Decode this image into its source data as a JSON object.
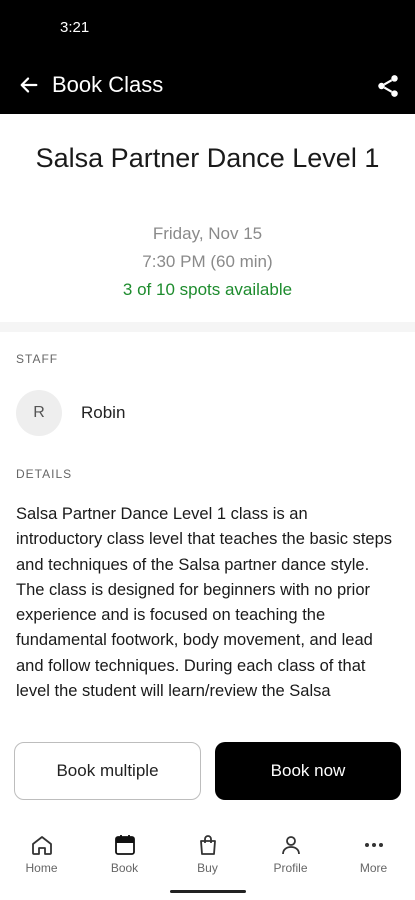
{
  "status_bar": {
    "time": "3:21"
  },
  "app_bar": {
    "title": "Book Class",
    "back_icon": "arrow-left-icon",
    "share_icon": "share-icon"
  },
  "class_info": {
    "title": "Salsa Partner Dance Level 1",
    "date": "Friday, Nov 15",
    "time": "7:30 PM (60 min)",
    "spots": "3 of 10 spots available"
  },
  "staff": {
    "label": "STAFF",
    "avatar_initial": "R",
    "name": "Robin"
  },
  "details": {
    "label": "DETAILS",
    "text": "Salsa Partner Dance Level 1 class is an introductory class level that teaches the basic steps and techniques of the Salsa partner dance style. The class is designed for beginners with no prior experience and is focused on teaching the fundamental footwork, body movement, and lead and follow techniques. During each class of that level the student will learn/review the Salsa"
  },
  "actions": {
    "book_multiple": "Book multiple",
    "book_now": "Book now"
  },
  "bottom_nav": {
    "items": [
      {
        "label": "Home",
        "icon": "home-icon"
      },
      {
        "label": "Book",
        "icon": "calendar-icon"
      },
      {
        "label": "Buy",
        "icon": "shopping-bag-icon"
      },
      {
        "label": "Profile",
        "icon": "person-icon"
      },
      {
        "label": "More",
        "icon": "more-dots-icon"
      }
    ]
  },
  "colors": {
    "bar_background": "#000000",
    "spots_green": "#1e8c2e",
    "muted_text": "#8a8a8a"
  }
}
